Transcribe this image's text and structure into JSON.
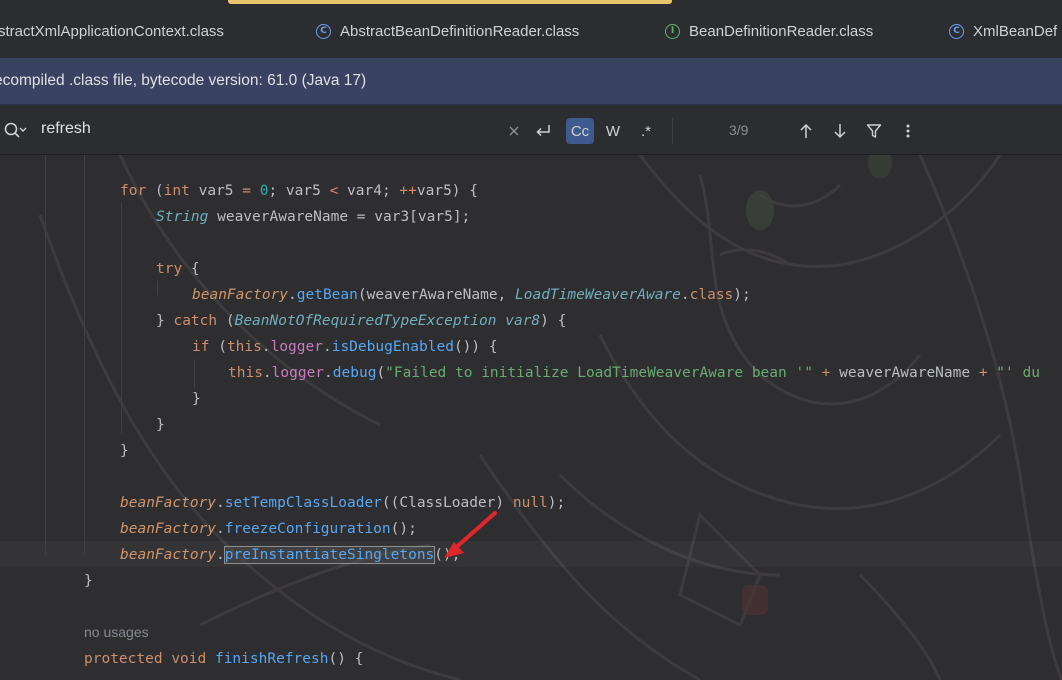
{
  "tabs": [
    {
      "label": "stractXmlApplicationContext.class",
      "icon": "class-icon"
    },
    {
      "label": "AbstractBeanDefinitionReader.class",
      "icon": "class-icon"
    },
    {
      "label": "BeanDefinitionReader.class",
      "icon": "interface-icon"
    },
    {
      "label": "XmlBeanDef",
      "icon": "class-icon"
    }
  ],
  "banner": {
    "text": "ecompiled .class file, bytecode version: 61.0 (Java 17)"
  },
  "search": {
    "query": "refresh",
    "match_case_label": "Cc",
    "words_label": "W",
    "regex_label": ".*",
    "match_count": "3/9"
  },
  "code": {
    "l1": {
      "kw_for": "for",
      "p1": " (",
      "kw_int": "int",
      "p2": " var5 ",
      "op_eq": "=",
      "sp1": " ",
      "zero": "0",
      "p3": "; var5 ",
      "op_lt": "<",
      "p4": " var4; ",
      "op_inc": "++",
      "p5": "var5) {"
    },
    "l2": {
      "type": "String",
      "rest": " weaverAwareName = var3[var5];"
    },
    "l3": {
      "kw_try": "try",
      "rest": " {"
    },
    "l4": {
      "var": "beanFactory",
      "dot": ".",
      "method": "getBean",
      "p1": "(weaverAwareName, ",
      "type": "LoadTimeWeaverAware",
      "p2": ".",
      "kw_class": "class",
      "p3": ");"
    },
    "l5": {
      "p0": "} ",
      "kw_catch": "catch",
      "p1": " (",
      "type": "BeanNotOfRequiredTypeException",
      "sp": " ",
      "var": "var8",
      "p2": ") {"
    },
    "l6": {
      "kw_if": "if",
      "p1": " (",
      "kw_this": "this",
      "dot1": ".",
      "field": "logger",
      "dot2": ".",
      "method": "isDebugEnabled",
      "p2": "()) {"
    },
    "l7": {
      "kw_this": "this",
      "dot1": ".",
      "field": "logger",
      "dot2": ".",
      "method": "debug",
      "p1": "(",
      "str1": "\"Failed to initialize LoadTimeWeaverAware bean '\"",
      "op1": " + ",
      "ident": "weaverAwareName",
      "op2": " + ",
      "str2": "\"' du"
    },
    "l8": {
      "brace": "}"
    },
    "l9": {
      "brace": "}"
    },
    "l10": {
      "brace": "}"
    },
    "l11": {
      "var": "beanFactory",
      "dot": ".",
      "method": "setTempClassLoader",
      "p1": "((ClassLoader) ",
      "kw_null": "null",
      "p2": ");"
    },
    "l12": {
      "var": "beanFactory",
      "dot": ".",
      "method": "freezeConfiguration",
      "p1": "();"
    },
    "l13": {
      "var": "beanFactory",
      "dot": ".",
      "method": "preInstantiateSingletons",
      "p1": "();"
    },
    "l14": {
      "brace": "}"
    },
    "hint": "no usages",
    "l15": {
      "kw_protected": "protected",
      "sp1": " ",
      "kw_void": "void",
      "sp2": " ",
      "method": "finishRefresh",
      "p1": "() {"
    }
  },
  "colors": {
    "keyword": "#cf8e6d",
    "number": "#2aacb8",
    "type": "#6fafbd",
    "field": "#c77dbb",
    "local": "#d0966a",
    "string": "#6aab73",
    "method": "#56a8f5",
    "annotation_arrow": "#e0262a"
  }
}
